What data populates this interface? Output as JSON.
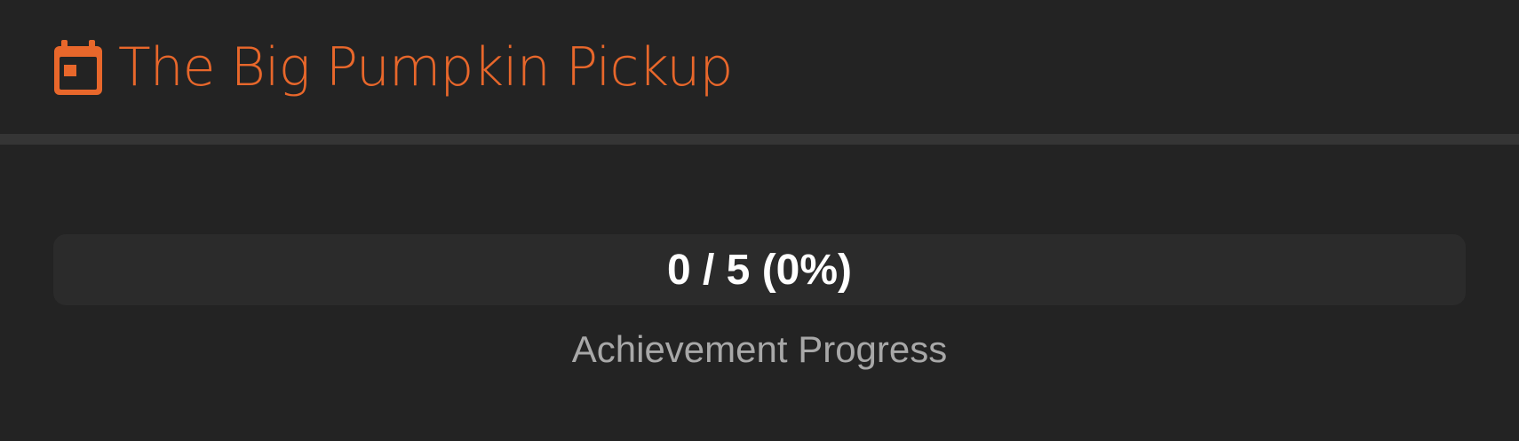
{
  "header": {
    "title": "The Big Pumpkin Pickup",
    "icon": "calendar-icon",
    "accent_color": "#e8672b"
  },
  "progress": {
    "current": 0,
    "total": 5,
    "percent": 0,
    "label": "0 / 5 (0%)",
    "caption": "Achievement Progress"
  }
}
